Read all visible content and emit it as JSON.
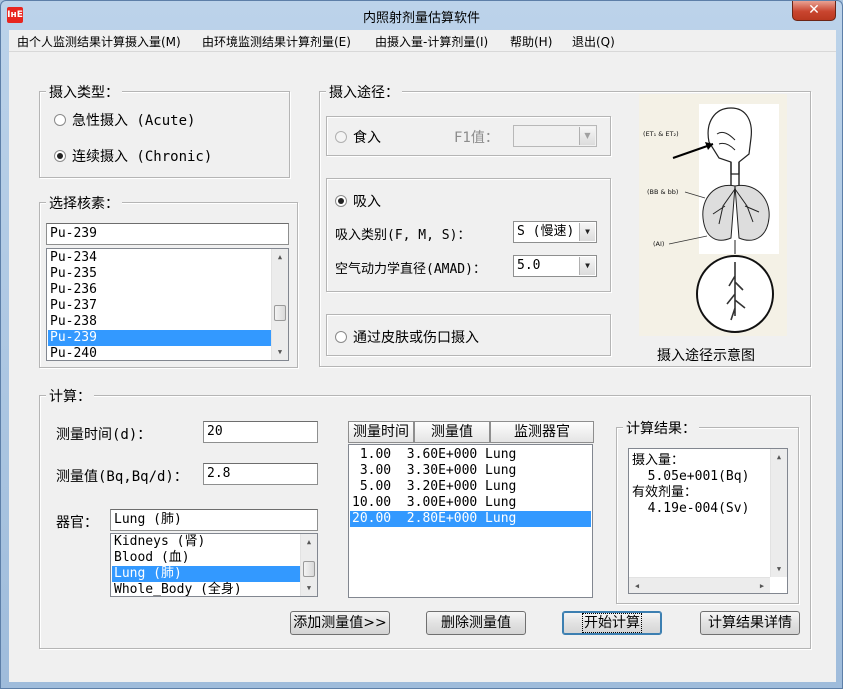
{
  "window": {
    "title": "内照射剂量估算软件",
    "icon_text": "IнE",
    "close_glyph": "✕"
  },
  "menu": [
    "由个人监测结果计算摄入量(M)",
    "由环境监测结果计算剂量(E)",
    "由摄入量-计算剂量(I)",
    "帮助(H)",
    "退出(Q)"
  ],
  "intake_type": {
    "legend": "摄入类型：",
    "acute": "急性摄入 (Acute)",
    "chronic": "连续摄入 (Chronic)",
    "selected": "chronic"
  },
  "nuclide": {
    "legend": "选择核素：",
    "value": "Pu-239",
    "items": [
      "Pu-234",
      "Pu-235",
      "Pu-236",
      "Pu-237",
      "Pu-238",
      "Pu-239",
      "Pu-240"
    ],
    "selected_index": 5
  },
  "route": {
    "legend": "摄入途径：",
    "ingestion": "食入",
    "f1_label": "F1值：",
    "f1_value": "",
    "inhalation": "吸入",
    "class_label": "吸入类别(F, M, S)：",
    "class_value": "S (慢速)",
    "amad_label": "空气动力学直径(AMAD)：",
    "amad_value": "5.0",
    "skin": "通过皮肤或伤口摄入",
    "selected": "inhalation"
  },
  "diagram": {
    "caption": "摄入途径示意图",
    "label_et": "(ET₁ & ET₂)",
    "label_bb": "(BB & bb)",
    "label_ai": "(AI)"
  },
  "calc": {
    "legend": "计算：",
    "time_label": "测量时间(d)：",
    "time_value": "20",
    "value_label": "测量值(Bq,Bq/d)：",
    "value_value": "2.8",
    "organ_label": "器官：",
    "organ_value": "Lung (肺)",
    "organ_items": [
      "Kidneys (肾)",
      "Blood (血)",
      "Lung (肺)",
      "Whole_Body (全身)"
    ],
    "organ_selected": 2
  },
  "measurements": {
    "headers": [
      "测量时间",
      "测量值",
      "监测器官"
    ],
    "rows": [
      " 1.00  3.60E+000 Lung",
      " 3.00  3.30E+000 Lung",
      " 5.00  3.20E+000 Lung",
      "10.00  3.00E+000 Lung",
      "20.00  2.80E+000 Lung"
    ],
    "selected_index": 4
  },
  "result": {
    "legend": "计算结果：",
    "lines": [
      "摄入量：",
      "  5.05e+001(Bq)",
      "有效剂量：",
      "  4.19e-004(Sv)"
    ]
  },
  "buttons": {
    "add": "添加测量值>>",
    "delete": "删除测量值",
    "start": "开始计算",
    "details": "计算结果详情"
  }
}
